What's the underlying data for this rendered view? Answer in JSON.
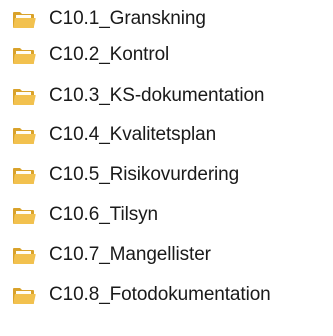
{
  "folders": [
    {
      "label": "C10.1_Granskning",
      "icon": "folder-icon"
    },
    {
      "label": "C10.2_Kontrol",
      "icon": "folder-icon"
    },
    {
      "label": "C10.3_KS-dokumentation",
      "icon": "folder-icon"
    },
    {
      "label": "C10.4_Kvalitetsplan",
      "icon": "folder-icon"
    },
    {
      "label": "C10.5_Risikovurdering",
      "icon": "folder-icon"
    },
    {
      "label": "C10.6_Tilsyn",
      "icon": "folder-icon"
    },
    {
      "label": "C10.7_Mangellister",
      "icon": "folder-icon"
    },
    {
      "label": "C10.8_Fotodokumentation",
      "icon": "folder-icon"
    }
  ],
  "colors": {
    "folder_front": "#f2c14e",
    "folder_back": "#d9a22a",
    "folder_paper": "#fffdf5",
    "text": "#1a1a1a"
  }
}
